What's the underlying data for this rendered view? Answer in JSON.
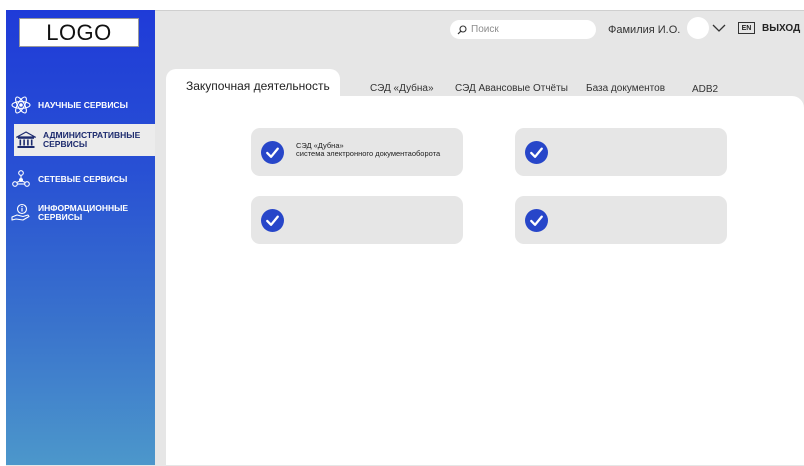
{
  "logo": "LOGO",
  "sidebar": {
    "items": [
      {
        "label": "НАУЧНЫЕ СЕРВИСЫ",
        "icon": "atom-icon"
      },
      {
        "label_line1": "АДМИНИСТРАТИВНЫЕ",
        "label_line2": "СЕРВИСЫ",
        "icon": "building-icon",
        "active": true
      },
      {
        "label": "СЕТЕВЫЕ СЕРВИСЫ",
        "icon": "network-icon"
      },
      {
        "label_line1": "ИНФОРМАЦИОННЫЕ",
        "label_line2": "СЕРВИСЫ",
        "icon": "info-hand-icon"
      }
    ]
  },
  "header": {
    "search_placeholder": "Поиск",
    "user_name": "Фамилия И.О.",
    "language": "EN",
    "logout": "ВЫХОД"
  },
  "tabs": [
    {
      "label": "Закупочная деятельность",
      "active": true
    },
    {
      "label": "СЭД «Дубна»"
    },
    {
      "label": "СЭД Авансовые Отчёты"
    },
    {
      "label": "База документов"
    },
    {
      "label": "ADB2"
    }
  ],
  "cards": [
    {
      "title": "СЭД «Дубна»",
      "subtitle": "система электронного документаоборота"
    },
    {
      "title": "",
      "subtitle": ""
    },
    {
      "title": "",
      "subtitle": ""
    },
    {
      "title": "",
      "subtitle": ""
    }
  ],
  "colors": {
    "sidebar_top": "#1f3bd8",
    "sidebar_bottom": "#4c97cb",
    "check": "#2746c9",
    "background": "#e6e6e6"
  }
}
